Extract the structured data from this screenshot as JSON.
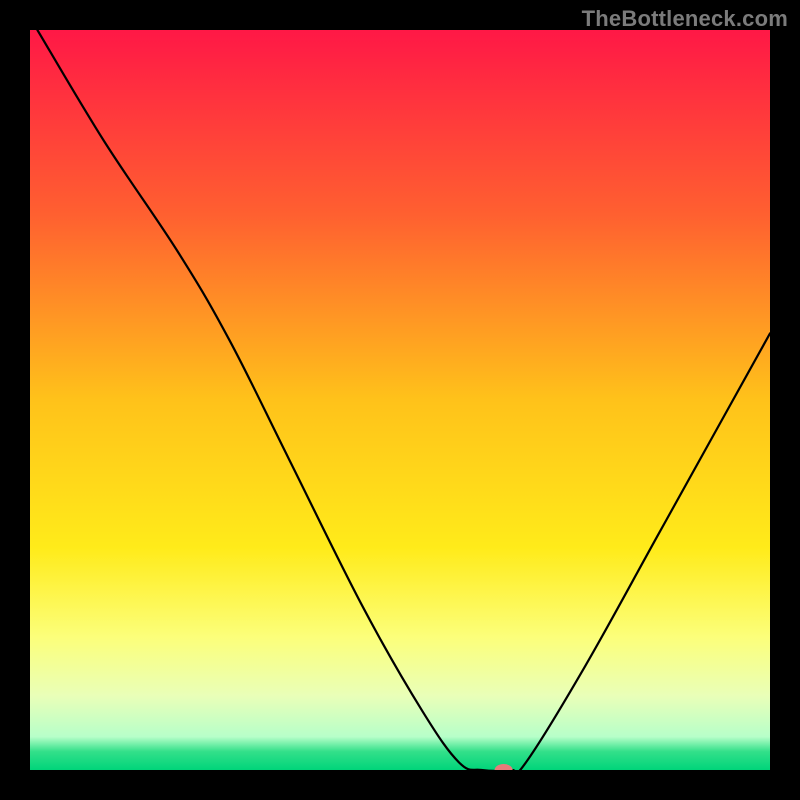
{
  "watermark": "TheBottleneck.com",
  "chart_data": {
    "type": "line",
    "title": "",
    "xlabel": "",
    "ylabel": "",
    "xlim": [
      0,
      100
    ],
    "ylim": [
      0,
      100
    ],
    "background_gradient_stops": [
      {
        "pos": 0.0,
        "color": "#ff1846"
      },
      {
        "pos": 0.25,
        "color": "#ff6030"
      },
      {
        "pos": 0.5,
        "color": "#ffc21a"
      },
      {
        "pos": 0.7,
        "color": "#ffeb1a"
      },
      {
        "pos": 0.82,
        "color": "#fcff7a"
      },
      {
        "pos": 0.9,
        "color": "#e9ffb8"
      },
      {
        "pos": 0.955,
        "color": "#b7ffc9"
      },
      {
        "pos": 0.975,
        "color": "#33e08a"
      },
      {
        "pos": 1.0,
        "color": "#00d47a"
      }
    ],
    "curve": {
      "comment": "y is 'bottleneck %' style metric; high at edges, dips to ~0 near x≈63; x is normalized 0-100 across plot width",
      "points": [
        {
          "x": 1,
          "y": 100
        },
        {
          "x": 10,
          "y": 85
        },
        {
          "x": 20,
          "y": 70
        },
        {
          "x": 27,
          "y": 58
        },
        {
          "x": 35,
          "y": 42
        },
        {
          "x": 45,
          "y": 22
        },
        {
          "x": 53,
          "y": 8
        },
        {
          "x": 58,
          "y": 1
        },
        {
          "x": 61,
          "y": 0
        },
        {
          "x": 65,
          "y": 0
        },
        {
          "x": 67,
          "y": 1
        },
        {
          "x": 75,
          "y": 14
        },
        {
          "x": 85,
          "y": 32
        },
        {
          "x": 95,
          "y": 50
        },
        {
          "x": 100,
          "y": 59
        }
      ]
    },
    "marker": {
      "x": 64,
      "y": 0,
      "color": "#e87a7a",
      "rx": 9,
      "ry": 6
    }
  }
}
